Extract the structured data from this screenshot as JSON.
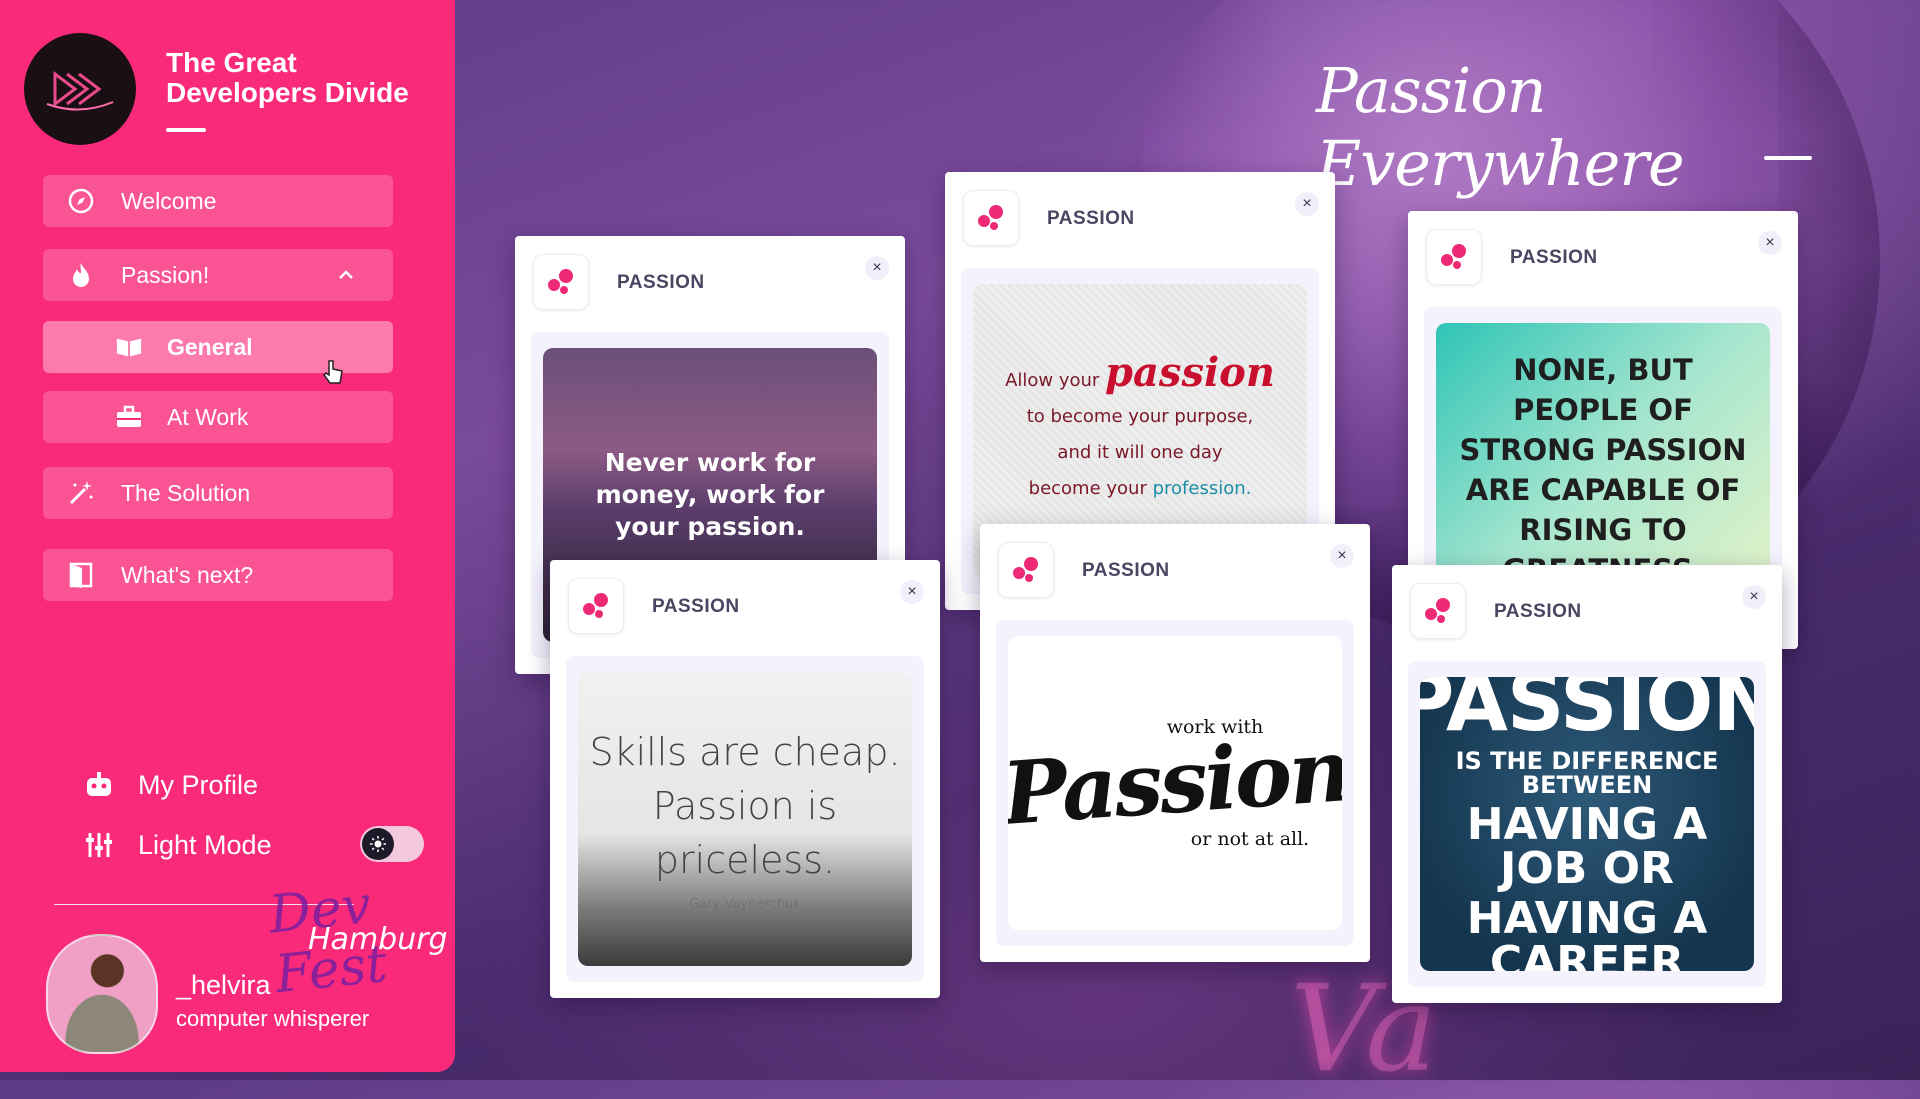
{
  "brand": {
    "title": "The Great Developers Divide"
  },
  "nav": {
    "welcome": "Welcome",
    "passion": "Passion!",
    "general": "General",
    "at_work": "At Work",
    "solution": "The Solution",
    "whats_next": "What's next?"
  },
  "bottom": {
    "profile": "My Profile",
    "light_mode": "Light Mode",
    "light_mode_on": false
  },
  "event": {
    "line1": "Dev Fest",
    "line2": "Hamburg"
  },
  "user": {
    "name": "_helvira",
    "role": "computer whisperer"
  },
  "page": {
    "title": "Passion Everywhere"
  },
  "colors": {
    "accent": "#fa2a7a",
    "dot": "#ee2a76"
  },
  "cards": [
    {
      "label": "PASSION",
      "close": "×",
      "quote": "Never work for money, work for your passion."
    },
    {
      "label": "PASSION",
      "close": "×",
      "quote_a": "Allow your",
      "quote_big": "passion",
      "quote_b": "to become your purpose,",
      "quote_c": "and it will one day",
      "quote_d": "become your",
      "quote_e": "profession."
    },
    {
      "label": "PASSION",
      "close": "×",
      "quote": "NONE, BUT PEOPLE OF STRONG PASSION ARE CAPABLE OF RISING TO GREATNESS."
    },
    {
      "label": "PASSION",
      "close": "×",
      "quote_a": "Skills are cheap.",
      "quote_b": "Passion is priceless.",
      "author": "Gary Vaynerchuk"
    },
    {
      "label": "PASSION",
      "close": "×",
      "quote_a": "work with",
      "quote_big": "Passion",
      "quote_b": "or not at all."
    },
    {
      "label": "PASSION",
      "close": "×",
      "quote_big": "PASSION",
      "quote_a": "IS THE DIFFERENCE BETWEEN",
      "quote_b": "HAVING A JOB OR",
      "quote_c": "HAVING A CAREER"
    }
  ]
}
